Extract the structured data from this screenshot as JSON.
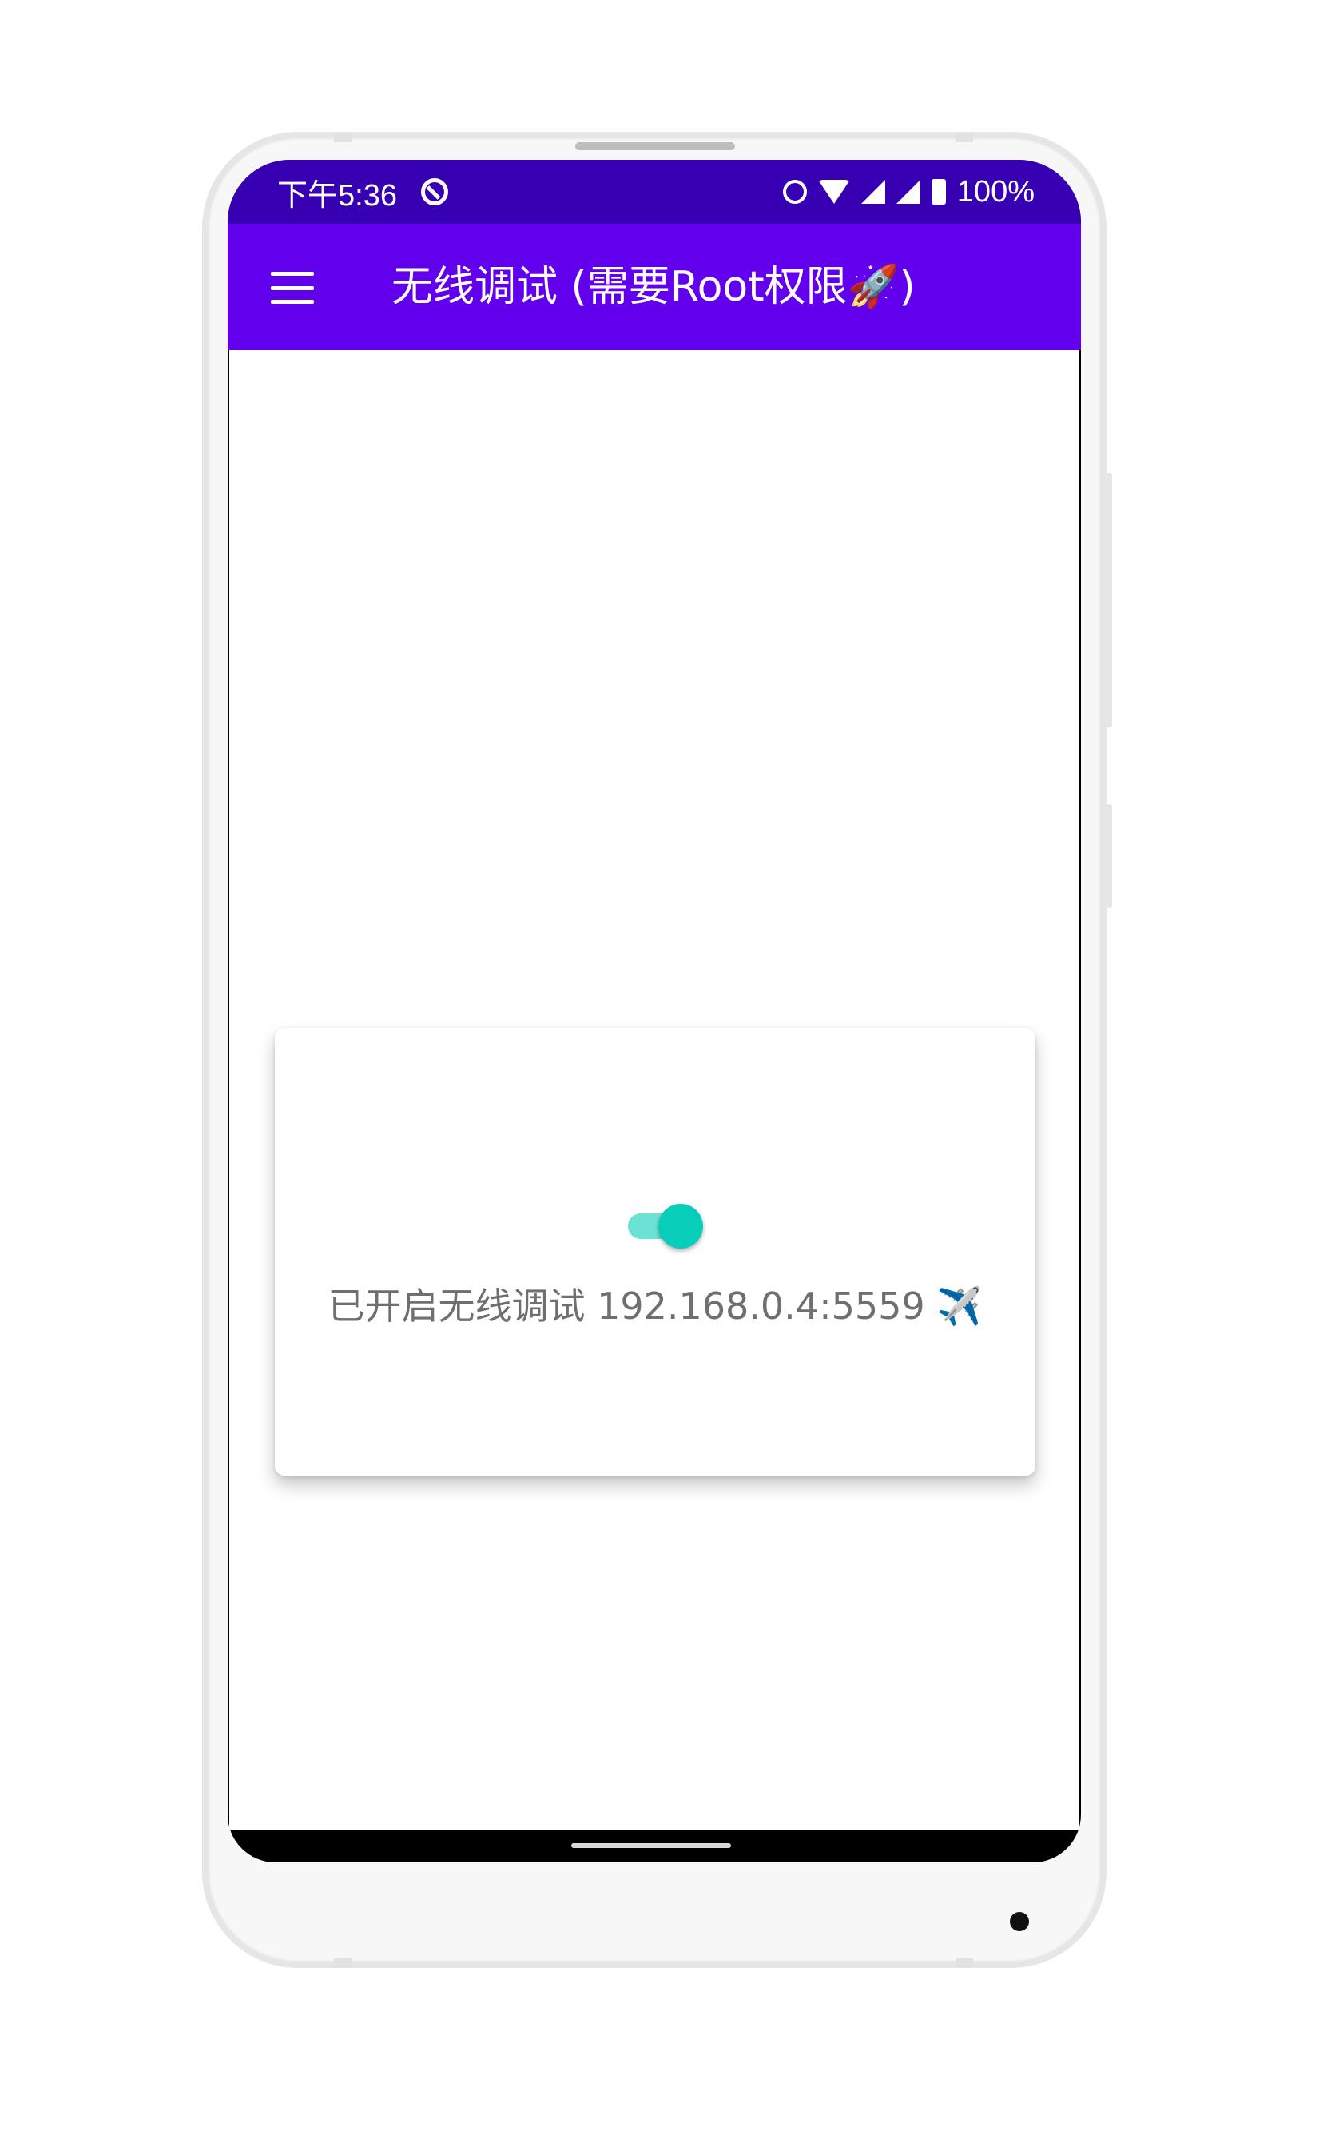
{
  "status_bar": {
    "time": "下午5:36",
    "battery": "100%"
  },
  "app_bar": {
    "title": "无线调试 (需要Root权限🚀)"
  },
  "card": {
    "toggle_on": true,
    "status_text": "已开启无线调试 192.168.0.4:5559 ✈️"
  },
  "colors": {
    "status_bar": "#3700b3",
    "app_bar": "#6200ee",
    "switch_thumb": "#08cdb8",
    "switch_track": "#6be3d4"
  }
}
